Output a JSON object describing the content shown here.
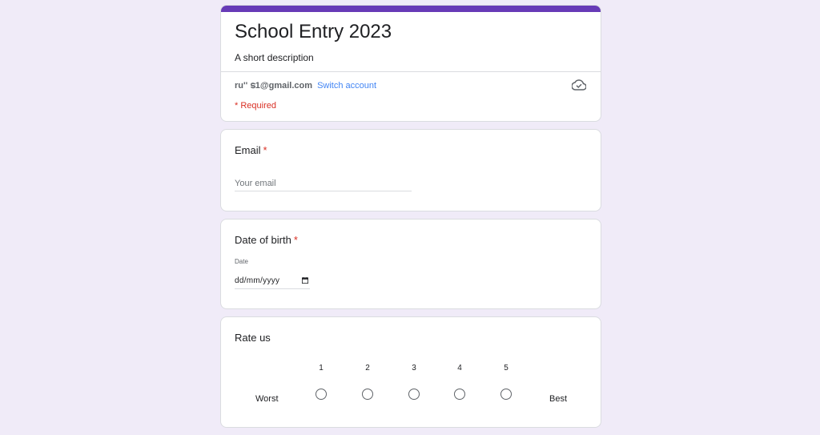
{
  "form": {
    "title": "School Entry 2023",
    "description": "A short description",
    "account_email": "ru'' ട1@gmail.com",
    "switch_account": "Switch account",
    "required_note": "* Required",
    "accent_color": "#673ab7",
    "cloud_icon": "cloud-saved-icon"
  },
  "questions": {
    "email": {
      "title": "Email",
      "required_mark": "*",
      "placeholder": "Your email"
    },
    "dob": {
      "title": "Date of birth",
      "required_mark": "*",
      "sub_label": "Date",
      "value": "dd/mm/yyyy",
      "icon": "calendar-icon"
    },
    "rating": {
      "title": "Rate us",
      "low_label": "Worst",
      "high_label": "Best",
      "options": [
        "1",
        "2",
        "3",
        "4",
        "5"
      ],
      "selected": null
    }
  }
}
